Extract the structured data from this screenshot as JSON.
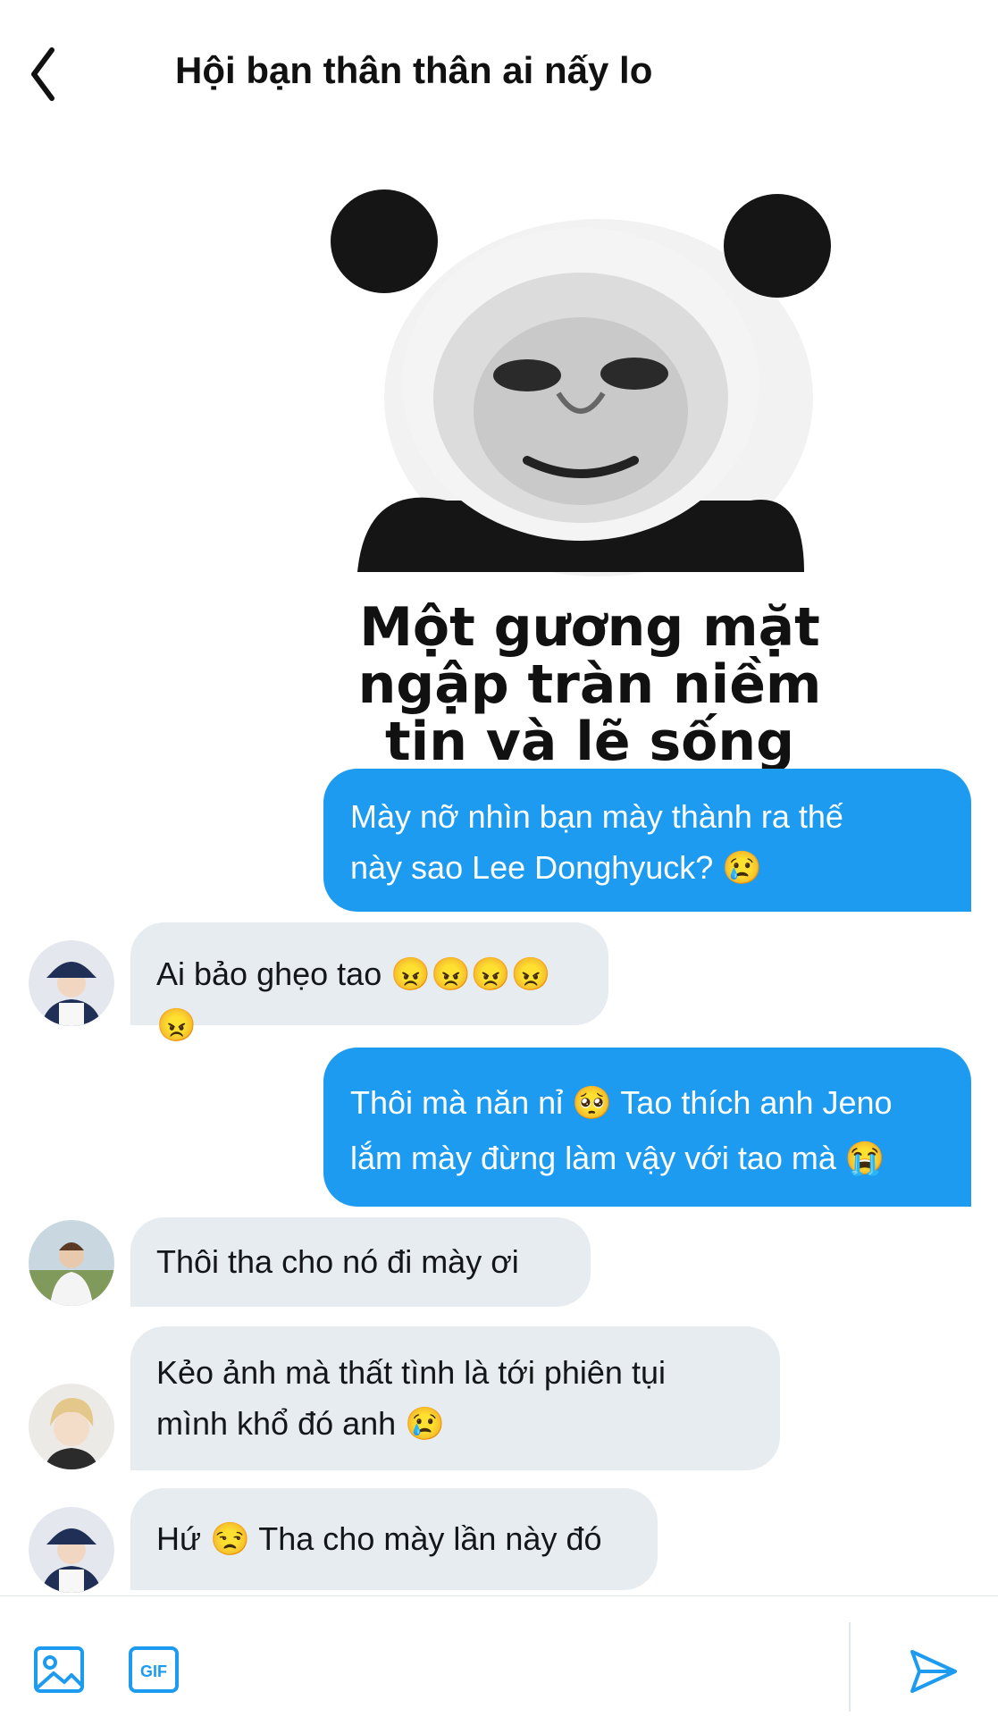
{
  "header": {
    "title": "Hội bạn thân thân ai nấy lo"
  },
  "meme": {
    "caption_lines": [
      "Một gương mặt",
      "ngập tràn niềm",
      "tin và lẽ sống"
    ]
  },
  "messages": [
    {
      "direction": "sent",
      "lines": [
        "Mày nỡ nhìn bạn mày thành ra thế",
        "này sao Lee Donghyuck? 😢"
      ]
    },
    {
      "direction": "received",
      "avatar": "avatar-bucket-hat",
      "lines": [
        "Ai bảo ghẹo tao 😠😠😠😠😠"
      ]
    },
    {
      "direction": "sent",
      "lines": [
        "Thôi mà năn nỉ 🥺 Tao thích anh Jeno",
        "lắm mày đừng làm vậy với tao mà 😭"
      ]
    },
    {
      "direction": "received",
      "avatar": "avatar-field",
      "lines": [
        "Thôi tha cho nó đi mày ơi"
      ]
    },
    {
      "direction": "received",
      "avatar": "avatar-blonde",
      "lines": [
        "Kẻo ảnh mà thất tình là tới phiên tụi",
        "mình khổ đó anh 😢"
      ]
    },
    {
      "direction": "received",
      "avatar": "avatar-bucket-hat",
      "lines": [
        "Hứ 😒 Tha cho mày lần này đó"
      ]
    }
  ],
  "composer": {
    "gif_label": "GIF",
    "icons": [
      "image-icon",
      "gif-icon",
      "send-icon"
    ]
  },
  "colors": {
    "sent_bubble": "#1d9bf0",
    "received_bubble": "#e6ecf0",
    "accent": "#1d9bf0"
  }
}
